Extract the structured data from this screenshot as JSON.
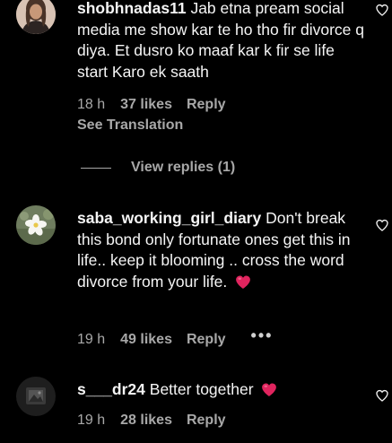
{
  "comments": [
    {
      "username": "shobhnadas11",
      "text": "Jab etna pream social media me show kar te ho tho fir divorce q diya. Et dusro ko maaf kar k fir se life start Karo ek saath",
      "time": "18 h",
      "likes": "37 likes",
      "reply": "Reply",
      "translation": "See Translation",
      "view_replies": "View replies (1)",
      "avatar_icon": "woman-portrait-avatar"
    },
    {
      "username": "saba_working_girl_diary",
      "text": "Don't break this bond only fortunate ones get this in life.. keep it blooming .. cross the word divorce from your life.",
      "emoji": "red-heart-icon",
      "time": "19 h",
      "likes": "49 likes",
      "reply": "Reply",
      "more": "•••",
      "avatar_icon": "white-flower-avatar"
    },
    {
      "username": "s___dr24",
      "text": "Better together",
      "emoji": "red-heart-icon",
      "time": "19 h",
      "likes": "28 likes",
      "reply": "Reply",
      "avatar_icon": "dark-grey-avatar"
    }
  ],
  "colors": {
    "background": "#000000",
    "primary_text": "#f5f5f5",
    "secondary_text": "#a8a8a8",
    "heart": "#e0245e"
  }
}
